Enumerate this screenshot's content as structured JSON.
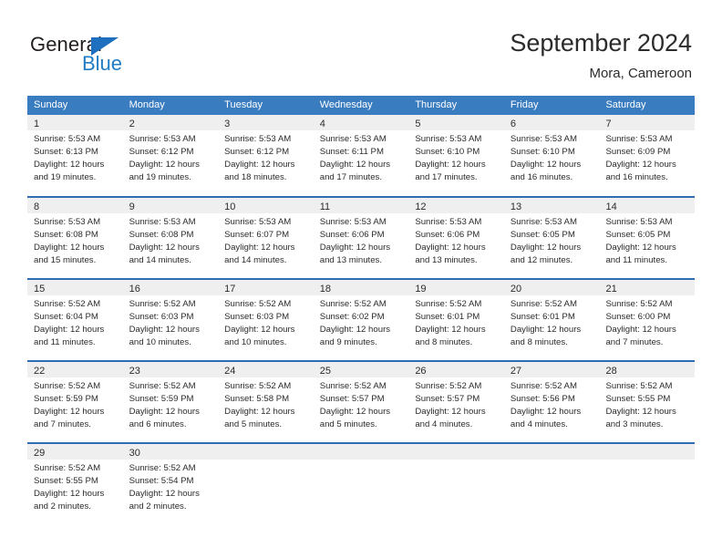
{
  "brand": {
    "name_part1": "General",
    "name_part2": "Blue"
  },
  "header": {
    "title": "September 2024",
    "subtitle": "Mora, Cameroon"
  },
  "weekdays": [
    "Sunday",
    "Monday",
    "Tuesday",
    "Wednesday",
    "Thursday",
    "Friday",
    "Saturday"
  ],
  "colors": {
    "header_blue": "#3a7cc0",
    "row_border_blue": "#2e6db4",
    "day_band_gray": "#efefef",
    "logo_blue": "#1f7cc4",
    "text": "#2b2b2b"
  },
  "weeks": [
    [
      {
        "day": "1",
        "sunrise": "Sunrise: 5:53 AM",
        "sunset": "Sunset: 6:13 PM",
        "daylight1": "Daylight: 12 hours",
        "daylight2": "and 19 minutes."
      },
      {
        "day": "2",
        "sunrise": "Sunrise: 5:53 AM",
        "sunset": "Sunset: 6:12 PM",
        "daylight1": "Daylight: 12 hours",
        "daylight2": "and 19 minutes."
      },
      {
        "day": "3",
        "sunrise": "Sunrise: 5:53 AM",
        "sunset": "Sunset: 6:12 PM",
        "daylight1": "Daylight: 12 hours",
        "daylight2": "and 18 minutes."
      },
      {
        "day": "4",
        "sunrise": "Sunrise: 5:53 AM",
        "sunset": "Sunset: 6:11 PM",
        "daylight1": "Daylight: 12 hours",
        "daylight2": "and 17 minutes."
      },
      {
        "day": "5",
        "sunrise": "Sunrise: 5:53 AM",
        "sunset": "Sunset: 6:10 PM",
        "daylight1": "Daylight: 12 hours",
        "daylight2": "and 17 minutes."
      },
      {
        "day": "6",
        "sunrise": "Sunrise: 5:53 AM",
        "sunset": "Sunset: 6:10 PM",
        "daylight1": "Daylight: 12 hours",
        "daylight2": "and 16 minutes."
      },
      {
        "day": "7",
        "sunrise": "Sunrise: 5:53 AM",
        "sunset": "Sunset: 6:09 PM",
        "daylight1": "Daylight: 12 hours",
        "daylight2": "and 16 minutes."
      }
    ],
    [
      {
        "day": "8",
        "sunrise": "Sunrise: 5:53 AM",
        "sunset": "Sunset: 6:08 PM",
        "daylight1": "Daylight: 12 hours",
        "daylight2": "and 15 minutes."
      },
      {
        "day": "9",
        "sunrise": "Sunrise: 5:53 AM",
        "sunset": "Sunset: 6:08 PM",
        "daylight1": "Daylight: 12 hours",
        "daylight2": "and 14 minutes."
      },
      {
        "day": "10",
        "sunrise": "Sunrise: 5:53 AM",
        "sunset": "Sunset: 6:07 PM",
        "daylight1": "Daylight: 12 hours",
        "daylight2": "and 14 minutes."
      },
      {
        "day": "11",
        "sunrise": "Sunrise: 5:53 AM",
        "sunset": "Sunset: 6:06 PM",
        "daylight1": "Daylight: 12 hours",
        "daylight2": "and 13 minutes."
      },
      {
        "day": "12",
        "sunrise": "Sunrise: 5:53 AM",
        "sunset": "Sunset: 6:06 PM",
        "daylight1": "Daylight: 12 hours",
        "daylight2": "and 13 minutes."
      },
      {
        "day": "13",
        "sunrise": "Sunrise: 5:53 AM",
        "sunset": "Sunset: 6:05 PM",
        "daylight1": "Daylight: 12 hours",
        "daylight2": "and 12 minutes."
      },
      {
        "day": "14",
        "sunrise": "Sunrise: 5:53 AM",
        "sunset": "Sunset: 6:05 PM",
        "daylight1": "Daylight: 12 hours",
        "daylight2": "and 11 minutes."
      }
    ],
    [
      {
        "day": "15",
        "sunrise": "Sunrise: 5:52 AM",
        "sunset": "Sunset: 6:04 PM",
        "daylight1": "Daylight: 12 hours",
        "daylight2": "and 11 minutes."
      },
      {
        "day": "16",
        "sunrise": "Sunrise: 5:52 AM",
        "sunset": "Sunset: 6:03 PM",
        "daylight1": "Daylight: 12 hours",
        "daylight2": "and 10 minutes."
      },
      {
        "day": "17",
        "sunrise": "Sunrise: 5:52 AM",
        "sunset": "Sunset: 6:03 PM",
        "daylight1": "Daylight: 12 hours",
        "daylight2": "and 10 minutes."
      },
      {
        "day": "18",
        "sunrise": "Sunrise: 5:52 AM",
        "sunset": "Sunset: 6:02 PM",
        "daylight1": "Daylight: 12 hours",
        "daylight2": "and 9 minutes."
      },
      {
        "day": "19",
        "sunrise": "Sunrise: 5:52 AM",
        "sunset": "Sunset: 6:01 PM",
        "daylight1": "Daylight: 12 hours",
        "daylight2": "and 8 minutes."
      },
      {
        "day": "20",
        "sunrise": "Sunrise: 5:52 AM",
        "sunset": "Sunset: 6:01 PM",
        "daylight1": "Daylight: 12 hours",
        "daylight2": "and 8 minutes."
      },
      {
        "day": "21",
        "sunrise": "Sunrise: 5:52 AM",
        "sunset": "Sunset: 6:00 PM",
        "daylight1": "Daylight: 12 hours",
        "daylight2": "and 7 minutes."
      }
    ],
    [
      {
        "day": "22",
        "sunrise": "Sunrise: 5:52 AM",
        "sunset": "Sunset: 5:59 PM",
        "daylight1": "Daylight: 12 hours",
        "daylight2": "and 7 minutes."
      },
      {
        "day": "23",
        "sunrise": "Sunrise: 5:52 AM",
        "sunset": "Sunset: 5:59 PM",
        "daylight1": "Daylight: 12 hours",
        "daylight2": "and 6 minutes."
      },
      {
        "day": "24",
        "sunrise": "Sunrise: 5:52 AM",
        "sunset": "Sunset: 5:58 PM",
        "daylight1": "Daylight: 12 hours",
        "daylight2": "and 5 minutes."
      },
      {
        "day": "25",
        "sunrise": "Sunrise: 5:52 AM",
        "sunset": "Sunset: 5:57 PM",
        "daylight1": "Daylight: 12 hours",
        "daylight2": "and 5 minutes."
      },
      {
        "day": "26",
        "sunrise": "Sunrise: 5:52 AM",
        "sunset": "Sunset: 5:57 PM",
        "daylight1": "Daylight: 12 hours",
        "daylight2": "and 4 minutes."
      },
      {
        "day": "27",
        "sunrise": "Sunrise: 5:52 AM",
        "sunset": "Sunset: 5:56 PM",
        "daylight1": "Daylight: 12 hours",
        "daylight2": "and 4 minutes."
      },
      {
        "day": "28",
        "sunrise": "Sunrise: 5:52 AM",
        "sunset": "Sunset: 5:55 PM",
        "daylight1": "Daylight: 12 hours",
        "daylight2": "and 3 minutes."
      }
    ],
    [
      {
        "day": "29",
        "sunrise": "Sunrise: 5:52 AM",
        "sunset": "Sunset: 5:55 PM",
        "daylight1": "Daylight: 12 hours",
        "daylight2": "and 2 minutes."
      },
      {
        "day": "30",
        "sunrise": "Sunrise: 5:52 AM",
        "sunset": "Sunset: 5:54 PM",
        "daylight1": "Daylight: 12 hours",
        "daylight2": "and 2 minutes."
      },
      {
        "day": "",
        "sunrise": "",
        "sunset": "",
        "daylight1": "",
        "daylight2": ""
      },
      {
        "day": "",
        "sunrise": "",
        "sunset": "",
        "daylight1": "",
        "daylight2": ""
      },
      {
        "day": "",
        "sunrise": "",
        "sunset": "",
        "daylight1": "",
        "daylight2": ""
      },
      {
        "day": "",
        "sunrise": "",
        "sunset": "",
        "daylight1": "",
        "daylight2": ""
      },
      {
        "day": "",
        "sunrise": "",
        "sunset": "",
        "daylight1": "",
        "daylight2": ""
      }
    ]
  ]
}
